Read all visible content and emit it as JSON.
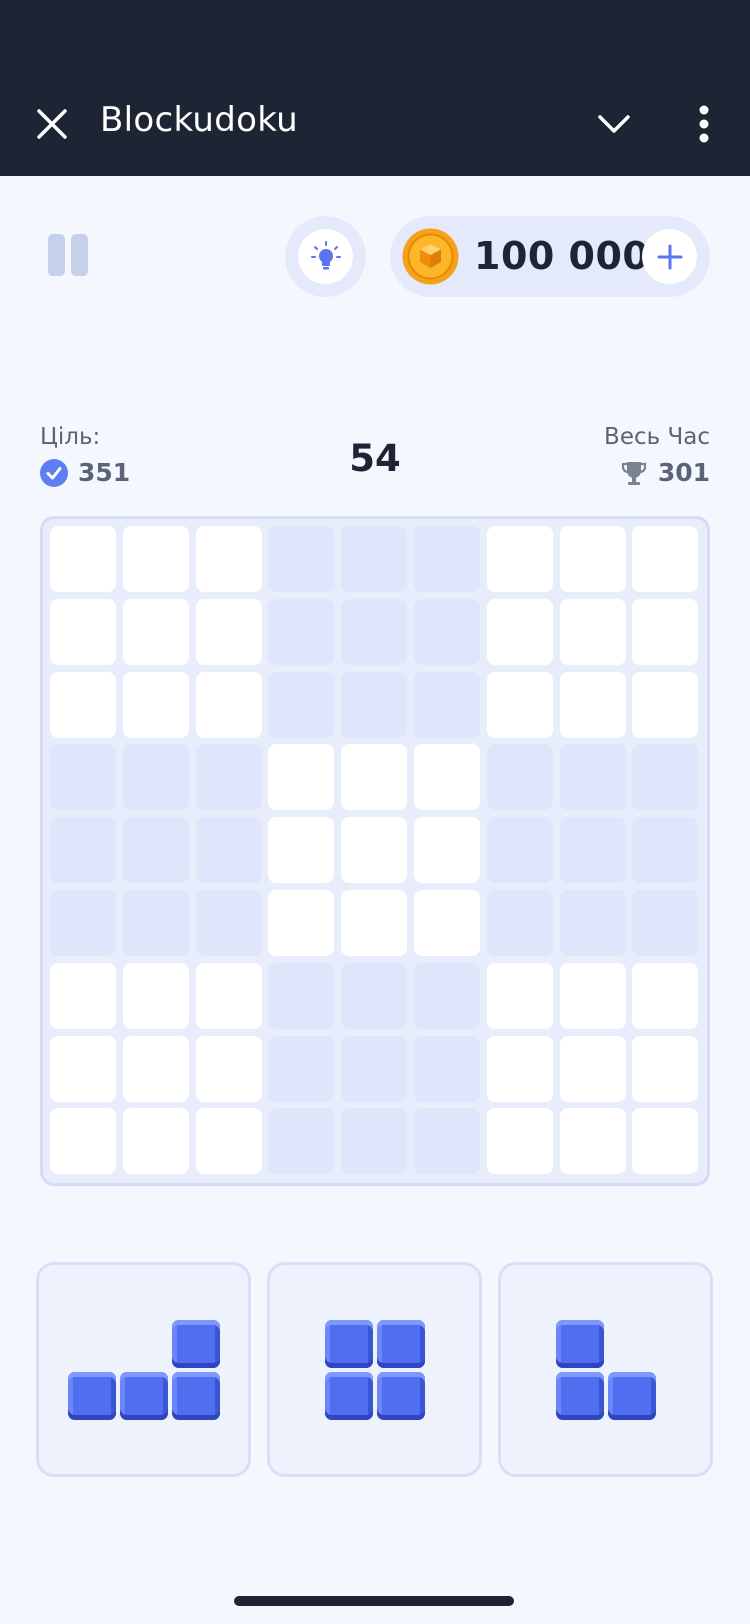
{
  "header": {
    "title": "Blockudoku",
    "close_icon": "close-icon",
    "collapse_icon": "chevron-down-icon",
    "menu_icon": "more-vertical-icon"
  },
  "toolbar": {
    "pause_icon": "pause-icon",
    "hint_icon": "lightbulb-icon",
    "coins": "100 000",
    "coin_icon": "coin-icon",
    "add_icon": "plus-icon"
  },
  "stats": {
    "goal_label": "Ціль:",
    "goal_value": "351",
    "score": "54",
    "best_label": "Весь Час",
    "best_value": "301"
  },
  "board": {
    "rows": 9,
    "cols": 9,
    "filled_cells": []
  },
  "pieces": [
    {
      "name": "piece-l-right",
      "cells": [
        [
          2,
          0
        ],
        [
          0,
          1
        ],
        [
          1,
          1
        ],
        [
          2,
          1
        ]
      ]
    },
    {
      "name": "piece-square",
      "cells": [
        [
          0,
          0
        ],
        [
          1,
          0
        ],
        [
          0,
          1
        ],
        [
          1,
          1
        ]
      ]
    },
    {
      "name": "piece-l-corner",
      "cells": [
        [
          0,
          0
        ],
        [
          0,
          1
        ],
        [
          1,
          1
        ]
      ]
    }
  ],
  "colors": {
    "header_bg": "#1d2535",
    "accent": "#4f6ff0",
    "block": "#4f6ff0",
    "coin": "#f59a0c"
  }
}
